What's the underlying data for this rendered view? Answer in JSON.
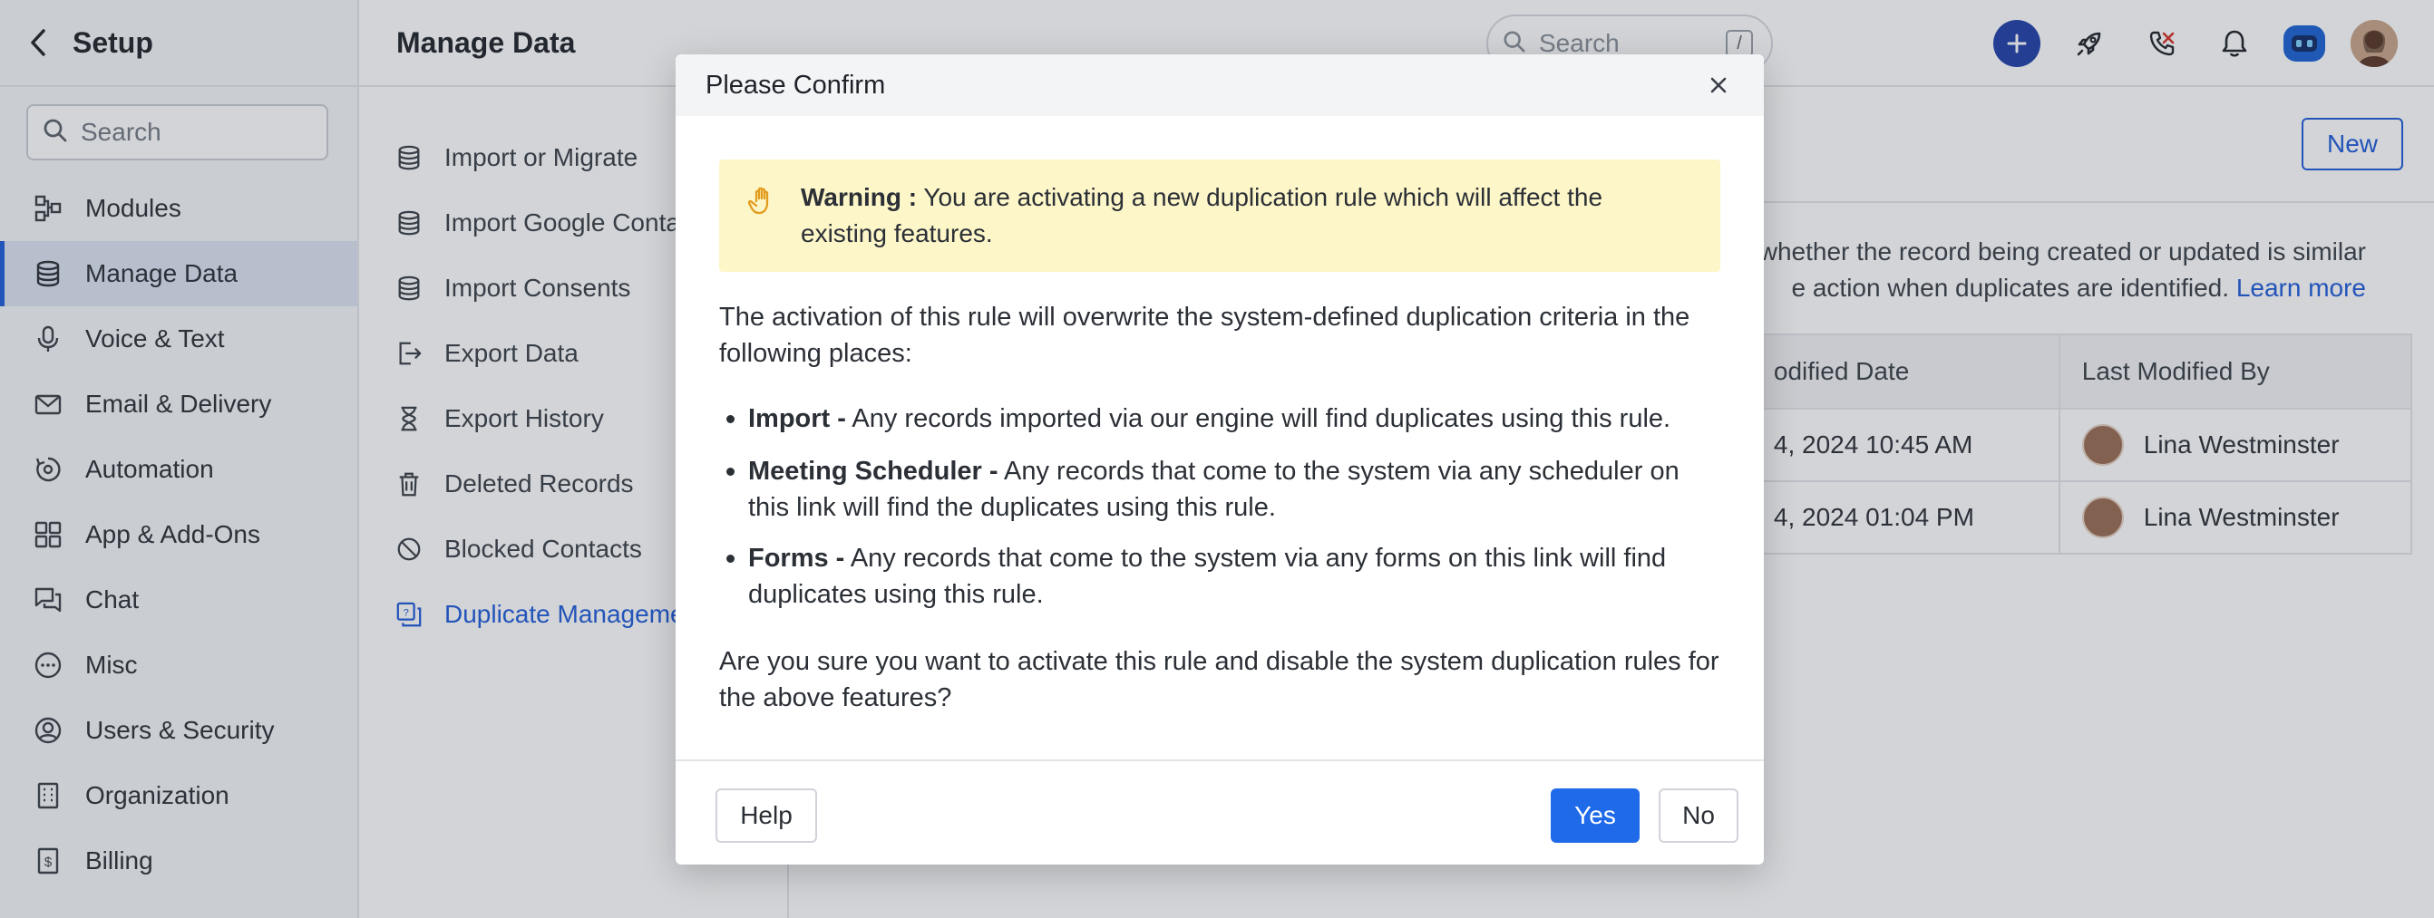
{
  "sidebar": {
    "title": "Setup",
    "search_placeholder": "Search",
    "items": [
      {
        "label": "Modules",
        "icon": "modules-icon"
      },
      {
        "label": "Manage Data",
        "icon": "database-icon",
        "active": true
      },
      {
        "label": "Voice & Text",
        "icon": "microphone-icon"
      },
      {
        "label": "Email & Delivery",
        "icon": "mail-icon"
      },
      {
        "label": "Automation",
        "icon": "automation-icon"
      },
      {
        "label": "App & Add-Ons",
        "icon": "apps-grid-icon"
      },
      {
        "label": "Chat",
        "icon": "chat-icon"
      },
      {
        "label": "Misc",
        "icon": "more-circle-icon"
      },
      {
        "label": "Users & Security",
        "icon": "user-circle-icon"
      },
      {
        "label": "Organization",
        "icon": "building-icon"
      },
      {
        "label": "Billing",
        "icon": "billing-icon"
      }
    ]
  },
  "header": {
    "title": "Manage Data",
    "search_placeholder": "Search",
    "search_shortcut": "/"
  },
  "submenu": {
    "items": [
      {
        "label": "Import or Migrate",
        "icon": "database-icon"
      },
      {
        "label": "Import Google Contacts",
        "icon": "database-icon"
      },
      {
        "label": "Import Consents",
        "icon": "database-icon"
      },
      {
        "label": "Export Data",
        "icon": "export-icon"
      },
      {
        "label": "Export History",
        "icon": "hourglass-icon"
      },
      {
        "label": "Deleted Records",
        "icon": "trash-icon"
      },
      {
        "label": "Blocked Contacts",
        "icon": "blocked-icon"
      },
      {
        "label": "Duplicate Management",
        "icon": "duplicate-icon",
        "active": true
      }
    ]
  },
  "main": {
    "new_button": "New",
    "description_line1": "whether the record being created or updated is similar",
    "description_line2": "e action when duplicates are identified.",
    "learn_more": "Learn more",
    "table": {
      "headers": [
        "odified Date",
        "Last Modified By"
      ],
      "rows": [
        {
          "date": "4, 2024 10:45 AM",
          "user": "Lina Westminster"
        },
        {
          "date": "4, 2024 01:04 PM",
          "user": "Lina Westminster"
        }
      ]
    }
  },
  "dialog": {
    "title": "Please Confirm",
    "warning_label": "Warning :",
    "warning_text": "You are activating a new duplication rule which will affect the existing features.",
    "intro": "The activation of this rule will overwrite the system-defined duplication criteria in the following places:",
    "bullets": [
      {
        "label": "Import -",
        "text": "Any records imported via our engine will find duplicates using this rule."
      },
      {
        "label": "Meeting Scheduler -",
        "text": "Any records that come to the system via any scheduler on this link will find the duplicates using this rule."
      },
      {
        "label": "Forms -",
        "text": "Any records that come to the system via any forms on this link will find duplicates using this rule."
      }
    ],
    "question": "Are you sure you want to activate this rule and disable the system duplication rules for the above features?",
    "help_button": "Help",
    "yes_button": "Yes",
    "no_button": "No"
  },
  "colors": {
    "accent": "#1f5bd9",
    "primary_button": "#1f6ae8",
    "warning_bg": "#fdf6c8",
    "warning_icon": "#e39b1c"
  }
}
